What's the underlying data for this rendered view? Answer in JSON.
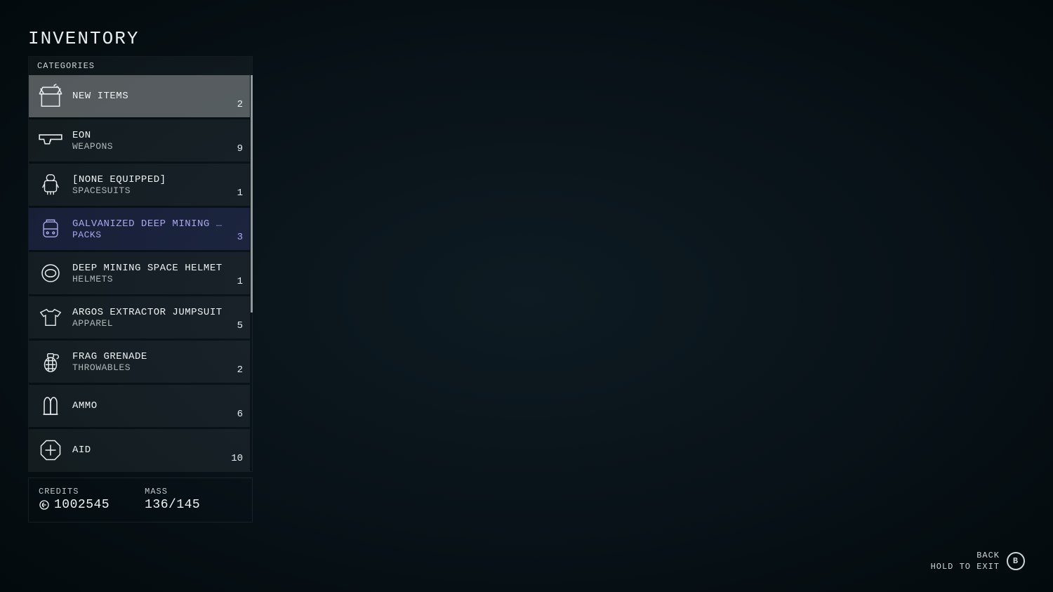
{
  "page_title": "INVENTORY",
  "categories_header": "CATEGORIES",
  "categories": [
    {
      "id": "new-items",
      "primary": "NEW ITEMS",
      "secondary": "",
      "count": 2,
      "state": "selected"
    },
    {
      "id": "weapons",
      "primary": "EON",
      "secondary": "WEAPONS",
      "count": 9,
      "state": "normal"
    },
    {
      "id": "spacesuits",
      "primary": "[NONE EQUIPPED]",
      "secondary": "SPACESUITS",
      "count": 1,
      "state": "normal"
    },
    {
      "id": "packs",
      "primary": "GALVANIZED DEEP MINING …",
      "secondary": "PACKS",
      "count": 3,
      "state": "equipped"
    },
    {
      "id": "helmets",
      "primary": "DEEP MINING SPACE HELMET",
      "secondary": "HELMETS",
      "count": 1,
      "state": "normal"
    },
    {
      "id": "apparel",
      "primary": "ARGOS EXTRACTOR JUMPSUIT",
      "secondary": "APPAREL",
      "count": 5,
      "state": "normal"
    },
    {
      "id": "throwables",
      "primary": "FRAG GRENADE",
      "secondary": "THROWABLES",
      "count": 2,
      "state": "normal"
    },
    {
      "id": "ammo",
      "primary": "AMMO",
      "secondary": "",
      "count": 6,
      "state": "normal"
    },
    {
      "id": "aid",
      "primary": "AID",
      "secondary": "",
      "count": 10,
      "state": "normal"
    }
  ],
  "stats": {
    "credits_label": "CREDITS",
    "credits_value": "1002545",
    "mass_label": "MASS",
    "mass_value": "136/145"
  },
  "footer": {
    "back_label": "BACK",
    "hold_label": "HOLD TO EXIT",
    "button_glyph": "B"
  }
}
